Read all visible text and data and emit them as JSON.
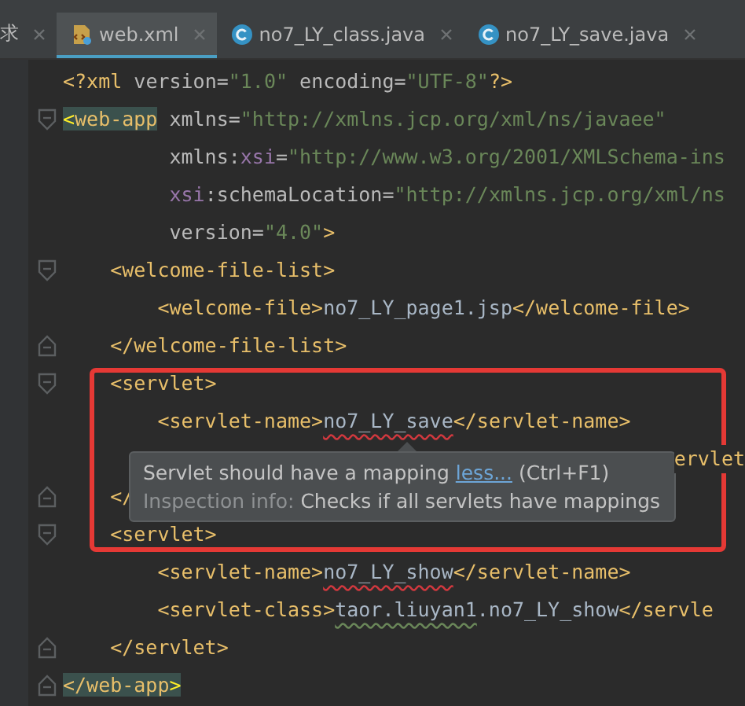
{
  "tabs": [
    {
      "label": "求",
      "kind": "plain",
      "selected": false
    },
    {
      "label": "web.xml",
      "kind": "xml",
      "selected": true
    },
    {
      "label": "no7_LY_class.java",
      "kind": "class",
      "selected": false
    },
    {
      "label": "no7_LY_save.java",
      "kind": "class",
      "selected": false
    }
  ],
  "editor": {
    "lines": [
      {
        "kind": "code",
        "fold_start": false,
        "fold_end": false,
        "tokens": [
          {
            "text": "<?xml",
            "kind": "tag"
          },
          {
            "text": " version=",
            "kind": "attr"
          },
          {
            "text": "\"1.0\"",
            "kind": "value"
          },
          {
            "text": " encoding=",
            "kind": "attr"
          },
          {
            "text": "\"UTF-8\"",
            "kind": "value"
          },
          {
            "text": "?>",
            "kind": "tag"
          }
        ]
      },
      {
        "kind": "code",
        "fold_start": true,
        "fold_end": false,
        "tokens": [
          {
            "text": "<",
            "kind": "bracket-match"
          },
          {
            "text": "web-app",
            "kind": "tag-match"
          },
          {
            "text": " xmlns=",
            "kind": "attr"
          },
          {
            "text": "\"http://xmlns.jcp.org/xml/ns/javaee\"",
            "kind": "value"
          }
        ]
      },
      {
        "kind": "code",
        "fold_start": false,
        "fold_end": false,
        "tokens": [
          {
            "text": "         xmlns:",
            "kind": "attr"
          },
          {
            "text": "xsi",
            "kind": "ns"
          },
          {
            "text": "=",
            "kind": "attr"
          },
          {
            "text": "\"http://www.w3.org/2001/XMLSchema-ins",
            "kind": "value"
          }
        ]
      },
      {
        "kind": "code",
        "fold_start": false,
        "fold_end": false,
        "tokens": [
          {
            "text": "         xsi",
            "kind": "ns"
          },
          {
            "text": ":schemaLocation=",
            "kind": "attr"
          },
          {
            "text": "\"http://xmlns.jcp.org/xml/ns",
            "kind": "value"
          }
        ]
      },
      {
        "kind": "code",
        "fold_start": false,
        "fold_end": false,
        "tokens": [
          {
            "text": "         version=",
            "kind": "attr"
          },
          {
            "text": "\"4.0\"",
            "kind": "value"
          },
          {
            "text": ">",
            "kind": "tag"
          }
        ]
      },
      {
        "kind": "code",
        "fold_start": true,
        "fold_end": false,
        "tokens": [
          {
            "text": "    <welcome-file-list>",
            "kind": "tag"
          }
        ]
      },
      {
        "kind": "code",
        "fold_start": false,
        "fold_end": false,
        "tokens": [
          {
            "text": "        <welcome-file>",
            "kind": "tag"
          },
          {
            "text": "no7_LY_page1.jsp",
            "kind": "text"
          },
          {
            "text": "</welcome-file>",
            "kind": "tag"
          }
        ]
      },
      {
        "kind": "code",
        "fold_start": false,
        "fold_end": true,
        "tokens": [
          {
            "text": "    </welcome-file-list>",
            "kind": "tag"
          }
        ]
      },
      {
        "kind": "code",
        "fold_start": true,
        "fold_end": false,
        "tokens": [
          {
            "text": "    <servlet>",
            "kind": "tag"
          }
        ]
      },
      {
        "kind": "code",
        "fold_start": false,
        "fold_end": false,
        "tokens": [
          {
            "text": "        <servlet-name>",
            "kind": "tag"
          },
          {
            "text": "no7_LY_save",
            "kind": "text-error"
          },
          {
            "text": "</servlet-name>",
            "kind": "tag"
          }
        ]
      },
      {
        "kind": "covered",
        "fold_start": false,
        "fold_end": false,
        "tokens": [
          {
            "text": "ervlet",
            "kind": "tag"
          }
        ]
      },
      {
        "kind": "code",
        "fold_start": false,
        "fold_end": true,
        "tokens": [
          {
            "text": "    </",
            "kind": "tag"
          }
        ]
      },
      {
        "kind": "code",
        "fold_start": true,
        "fold_end": false,
        "tokens": [
          {
            "text": "    <servlet>",
            "kind": "tag"
          }
        ]
      },
      {
        "kind": "code",
        "fold_start": false,
        "fold_end": false,
        "tokens": [
          {
            "text": "        <servlet-name>",
            "kind": "tag"
          },
          {
            "text": "no7_LY_show",
            "kind": "text-error"
          },
          {
            "text": "</servlet-name>",
            "kind": "tag"
          }
        ]
      },
      {
        "kind": "code",
        "fold_start": false,
        "fold_end": false,
        "tokens": [
          {
            "text": "        <servlet-class>",
            "kind": "tag"
          },
          {
            "text": "taor.liuyan1",
            "kind": "text-warning"
          },
          {
            "text": ".no7_LY_show",
            "kind": "text"
          },
          {
            "text": "</servle",
            "kind": "tag"
          }
        ]
      },
      {
        "kind": "code",
        "fold_start": false,
        "fold_end": true,
        "tokens": [
          {
            "text": "    </servlet>",
            "kind": "tag"
          }
        ]
      },
      {
        "kind": "code",
        "fold_start": false,
        "fold_end": true,
        "tokens": [
          {
            "text": "</web-app",
            "kind": "tag-match"
          },
          {
            "text": ">",
            "kind": "bracket-match"
          }
        ]
      }
    ],
    "marked_box": true,
    "tooltip": {
      "message": "Servlet should have a mapping",
      "link": "less...",
      "shortcut": "(Ctrl+F1)",
      "info_label": "Inspection info:",
      "info_text": "Checks if all servlets have mappings"
    }
  }
}
